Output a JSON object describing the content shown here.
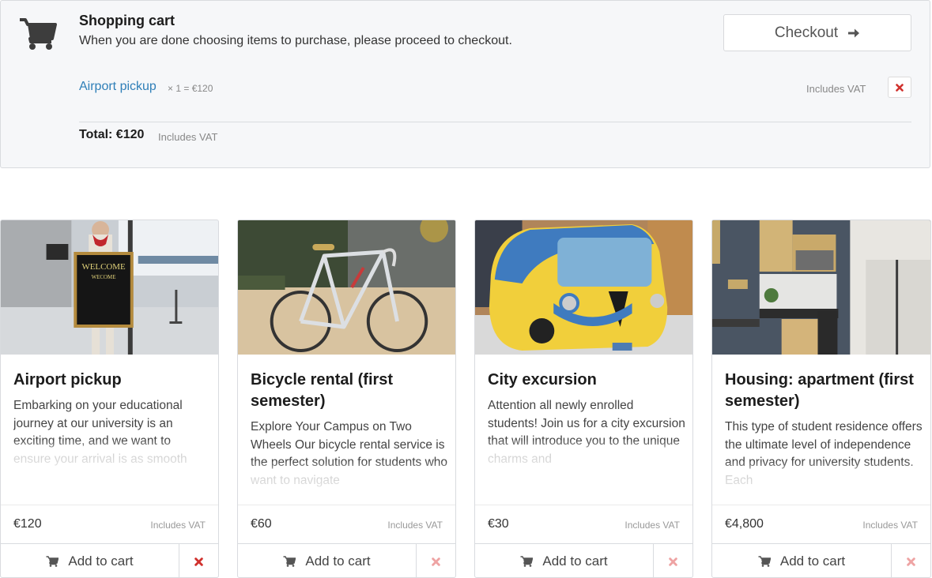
{
  "cart": {
    "icon": "shopping-cart-icon",
    "title": "Shopping cart",
    "subtitle": "When you are done choosing items to purchase, please proceed to checkout.",
    "checkout_label": "Checkout",
    "checkout_icon": "arrow-right-icon",
    "line_items": [
      {
        "name": "Airport pickup",
        "qty_text": "× 1 = €120",
        "vat_note": "Includes VAT",
        "remove_icon": "close-icon"
      }
    ],
    "total_label": "Total: €120",
    "total_vat_note": "Includes VAT"
  },
  "products": [
    {
      "title": "Airport pickup",
      "description": "Embarking on your educational journey at our university is an exciting time, and we want to ensure your arrival is as smooth",
      "price": "€120",
      "vat_note": "Includes VAT",
      "add_label": "Add to cart",
      "image": "airport-welcome-sign-image",
      "in_cart": true
    },
    {
      "title": "Bicycle rental (first semester)",
      "description": "Explore Your Campus on Two Wheels Our bicycle rental service is the perfect solution for students who want to navigate",
      "price": "€60",
      "vat_note": "Includes VAT",
      "add_label": "Add to cart",
      "image": "road-bicycle-image",
      "in_cart": false
    },
    {
      "title": "City excursion",
      "description": "Attention all newly enrolled students! Join us for a city excursion that will introduce you to the unique charms and",
      "price": "€30",
      "vat_note": "Includes VAT",
      "add_label": "Add to cart",
      "image": "yellow-blue-bus-image",
      "in_cart": false
    },
    {
      "title": "Housing: apartment (first semester)",
      "description": "This type of student residence offers the ultimate level of independence and privacy for university students. Each",
      "price": "€4,800",
      "vat_note": "Includes VAT",
      "add_label": "Add to cart",
      "image": "apartment-kitchen-image",
      "in_cart": false
    }
  ],
  "colors": {
    "link": "#2f7fb8",
    "remove_active": "#d0312d",
    "remove_inactive": "#eea3a3",
    "panel_bg": "#f6f7f9"
  }
}
